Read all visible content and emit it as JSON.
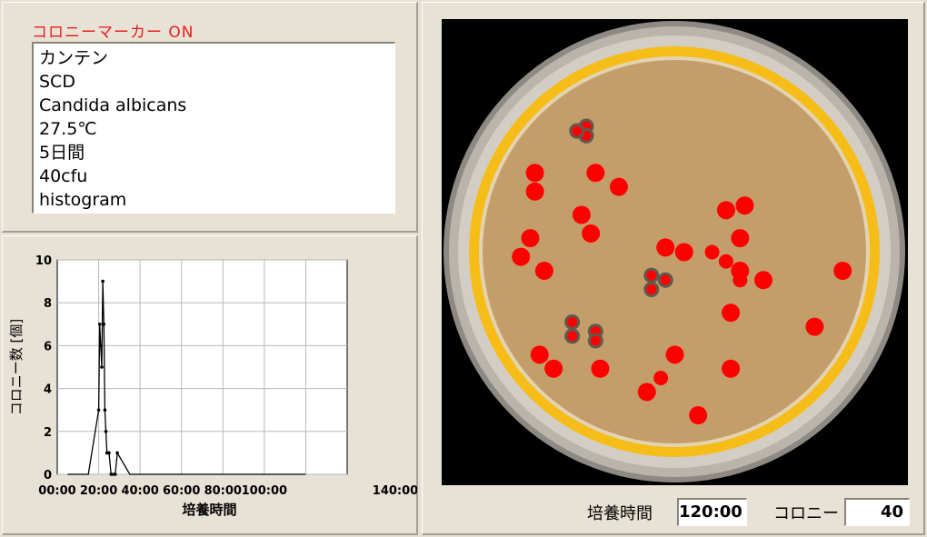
{
  "marker_label": "コロニーマーカー ON",
  "info_lines": [
    "カンテン",
    "SCD",
    "Candida albicans",
    "27.5℃",
    "5日間",
    "40cfu",
    "histogram"
  ],
  "bottom": {
    "time_label": "培養時間",
    "time_value": "120:00",
    "colony_label": "コロニー",
    "colony_value": "40"
  },
  "chart_data": {
    "type": "line",
    "xlabel": "培養時間",
    "ylabel": "コロニー数 [個]",
    "x_tick_labels": [
      "00:00",
      "20:00",
      "40:00",
      "60:00",
      "80:00",
      "100:00",
      "140:00"
    ],
    "y_tick_labels": [
      "0",
      "2",
      "4",
      "6",
      "8",
      "10"
    ],
    "xlim": [
      0,
      140
    ],
    "ylim": [
      0,
      10
    ],
    "grid": true,
    "series": [
      {
        "x": [
          5,
          10,
          15,
          20.0,
          20.5,
          21.0,
          21.5,
          22.0,
          22.5,
          23.0,
          23.5,
          24.0,
          24.5,
          25.0,
          26.0,
          27.0,
          28.0,
          29.0,
          35,
          45,
          55,
          65,
          75,
          85,
          95,
          105,
          115,
          120
        ],
        "y": [
          0,
          0,
          0,
          3,
          7,
          6,
          5,
          9,
          7,
          3,
          2,
          1,
          1,
          1,
          0,
          0,
          0,
          1,
          0,
          0,
          0,
          0,
          0,
          0,
          0,
          0,
          0,
          0
        ]
      }
    ]
  },
  "dish": {
    "colony_color": "#ff0000",
    "agar_color": "#c39e6a",
    "rim_color": "#f6bd18",
    "markers": [
      [
        0.31,
        0.23,
        "s"
      ],
      [
        0.31,
        0.25,
        "s"
      ],
      [
        0.29,
        0.24,
        "s"
      ],
      [
        0.2,
        0.33,
        "l"
      ],
      [
        0.2,
        0.37,
        "l"
      ],
      [
        0.33,
        0.33,
        "l"
      ],
      [
        0.38,
        0.36,
        "l"
      ],
      [
        0.3,
        0.42,
        "l"
      ],
      [
        0.32,
        0.46,
        "l"
      ],
      [
        0.19,
        0.47,
        "l"
      ],
      [
        0.17,
        0.51,
        "l"
      ],
      [
        0.22,
        0.54,
        "l"
      ],
      [
        0.45,
        0.55,
        "s"
      ],
      [
        0.45,
        0.58,
        "s"
      ],
      [
        0.48,
        0.56,
        "s"
      ],
      [
        0.48,
        0.49,
        "l"
      ],
      [
        0.52,
        0.5,
        "l"
      ],
      [
        0.58,
        0.5,
        "m"
      ],
      [
        0.61,
        0.52,
        "m"
      ],
      [
        0.64,
        0.54,
        "l"
      ],
      [
        0.64,
        0.47,
        "l"
      ],
      [
        0.61,
        0.41,
        "l"
      ],
      [
        0.65,
        0.4,
        "l"
      ],
      [
        0.69,
        0.56,
        "l"
      ],
      [
        0.86,
        0.54,
        "l"
      ],
      [
        0.28,
        0.65,
        "s"
      ],
      [
        0.28,
        0.68,
        "s"
      ],
      [
        0.33,
        0.67,
        "s"
      ],
      [
        0.33,
        0.69,
        "s"
      ],
      [
        0.21,
        0.72,
        "l"
      ],
      [
        0.24,
        0.75,
        "l"
      ],
      [
        0.34,
        0.75,
        "l"
      ],
      [
        0.5,
        0.72,
        "l"
      ],
      [
        0.47,
        0.77,
        "m"
      ],
      [
        0.44,
        0.8,
        "l"
      ],
      [
        0.62,
        0.63,
        "l"
      ],
      [
        0.62,
        0.75,
        "l"
      ],
      [
        0.8,
        0.66,
        "l"
      ],
      [
        0.55,
        0.85,
        "l"
      ],
      [
        0.64,
        0.56,
        "m"
      ]
    ]
  }
}
